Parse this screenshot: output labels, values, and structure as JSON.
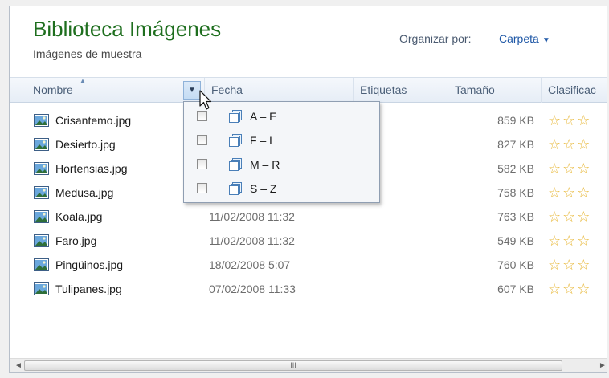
{
  "library": {
    "title": "Biblioteca Imágenes",
    "subtitle": "Imágenes de muestra"
  },
  "arrange": {
    "label": "Organizar por:",
    "value": "Carpeta"
  },
  "columns": {
    "name": "Nombre",
    "date": "Fecha",
    "tags": "Etiquetas",
    "size": "Tamaño",
    "rating": "Clasificac"
  },
  "files": [
    {
      "name": "Crisantemo.jpg",
      "date": "",
      "size": "859 KB",
      "stars": "☆☆☆"
    },
    {
      "name": "Desierto.jpg",
      "date": "",
      "size": "827 KB",
      "stars": "☆☆☆"
    },
    {
      "name": "Hortensias.jpg",
      "date": "",
      "size": "582 KB",
      "stars": "☆☆☆"
    },
    {
      "name": "Medusa.jpg",
      "date": "",
      "size": "758 KB",
      "stars": "☆☆☆"
    },
    {
      "name": "Koala.jpg",
      "date": "11/02/2008 11:32",
      "size": "763 KB",
      "stars": "☆☆☆"
    },
    {
      "name": "Faro.jpg",
      "date": "11/02/2008 11:32",
      "size": "549 KB",
      "stars": "☆☆☆"
    },
    {
      "name": "Pingüinos.jpg",
      "date": "18/02/2008 5:07",
      "size": "760 KB",
      "stars": "☆☆☆"
    },
    {
      "name": "Tulipanes.jpg",
      "date": "07/02/2008 11:33",
      "size": "607 KB",
      "stars": "☆☆☆"
    }
  ],
  "filter_menu": {
    "options": [
      "A – E",
      "F – L",
      "M – R",
      "S – Z"
    ]
  },
  "scrollbar": {
    "left": "◄",
    "right": "►",
    "grip": "III"
  },
  "icons": {
    "sort": "sort-ascending-icon",
    "filter": "dropdown-arrow-icon",
    "file": "image-file-icon",
    "group": "stacked-pages-icon",
    "cursor": "mouse-pointer-icon"
  },
  "colors": {
    "title": "#1e6e1e",
    "link": "#1e57a6",
    "stars": "#e8b83a"
  }
}
